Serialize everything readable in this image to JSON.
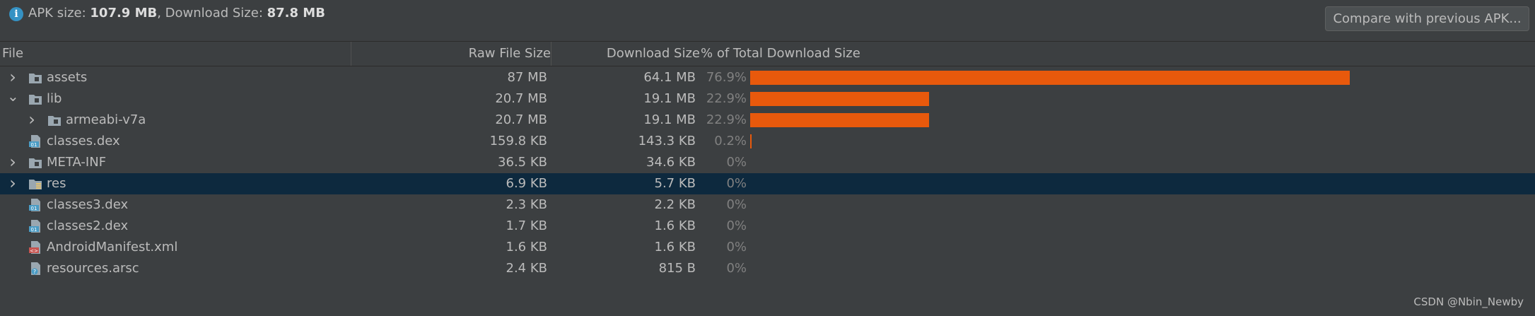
{
  "summary": {
    "apk_label": "APK size: ",
    "apk_value": "107.9 MB",
    "sep": ", Download Size: ",
    "download_value": "87.8 MB"
  },
  "compare_button": "Compare with previous APK...",
  "columns": {
    "file": "File",
    "raw": "Raw File Size",
    "download": "Download Size",
    "percent": "% of Total Download Size"
  },
  "colors": {
    "bar": "#e8590c",
    "selection": "#0d293e",
    "folder": "#9aa7b0",
    "dex": "#4a9cc5",
    "manifest": "#c75450"
  },
  "rows": [
    {
      "name": "assets",
      "raw": "87 MB",
      "download": "64.1 MB",
      "percent": "76.9%",
      "fraction": 0.769,
      "expander": "collapsed",
      "indent": 0,
      "icon": "folder-icon"
    },
    {
      "name": "lib",
      "raw": "20.7 MB",
      "download": "19.1 MB",
      "percent": "22.9%",
      "fraction": 0.229,
      "expander": "expanded",
      "indent": 0,
      "icon": "folder-icon"
    },
    {
      "name": "armeabi-v7a",
      "raw": "20.7 MB",
      "download": "19.1 MB",
      "percent": "22.9%",
      "fraction": 0.229,
      "expander": "collapsed",
      "indent": 1,
      "icon": "folder-icon"
    },
    {
      "name": "classes.dex",
      "raw": "159.8 KB",
      "download": "143.3 KB",
      "percent": "0.2%",
      "fraction": 0.002,
      "expander": "none",
      "indent": 0,
      "icon": "dex-file-icon"
    },
    {
      "name": "META-INF",
      "raw": "36.5 KB",
      "download": "34.6 KB",
      "percent": "0%",
      "fraction": 0,
      "expander": "collapsed",
      "indent": 0,
      "icon": "folder-icon"
    },
    {
      "name": "res",
      "raw": "6.9 KB",
      "download": "5.7 KB",
      "percent": "0%",
      "fraction": 0,
      "expander": "collapsed",
      "indent": 0,
      "icon": "res-folder-icon",
      "selected": true
    },
    {
      "name": "classes3.dex",
      "raw": "2.3 KB",
      "download": "2.2 KB",
      "percent": "0%",
      "fraction": 0,
      "expander": "none",
      "indent": 0,
      "icon": "dex-file-icon"
    },
    {
      "name": "classes2.dex",
      "raw": "1.7 KB",
      "download": "1.6 KB",
      "percent": "0%",
      "fraction": 0,
      "expander": "none",
      "indent": 0,
      "icon": "dex-file-icon"
    },
    {
      "name": "AndroidManifest.xml",
      "raw": "1.6 KB",
      "download": "1.6 KB",
      "percent": "0%",
      "fraction": 0,
      "expander": "none",
      "indent": 0,
      "icon": "xml-file-icon"
    },
    {
      "name": "resources.arsc",
      "raw": "2.4 KB",
      "download": "815 B",
      "percent": "0%",
      "fraction": 0,
      "expander": "none",
      "indent": 0,
      "icon": "arsc-file-icon"
    }
  ],
  "watermark": "CSDN @Nbin_Newby"
}
